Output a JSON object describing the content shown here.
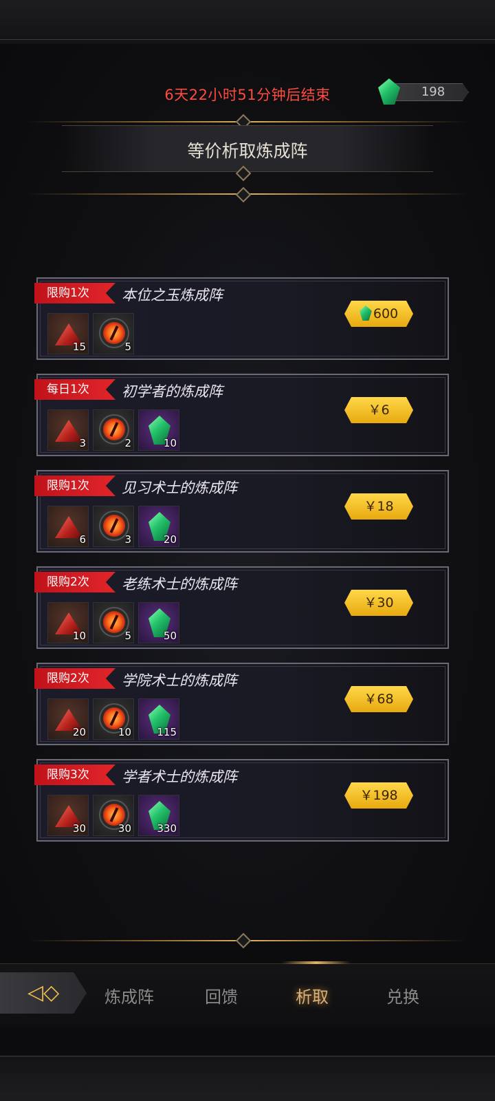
{
  "header": {
    "timer_text": "6天22小时51分钟后结束",
    "currency_count": "198",
    "currency_icon": "green-gem-icon",
    "title": "等价析取炼成阵"
  },
  "cards": [
    {
      "tag": "限购1次",
      "name": "本位之玉炼成阵",
      "items": [
        {
          "icon": "red-shard-icon",
          "count": "15"
        },
        {
          "icon": "fire-eye-icon",
          "count": "5"
        }
      ],
      "price": "600",
      "price_uses_gem": true
    },
    {
      "tag": "每日1次",
      "name": "初学者的炼成阵",
      "items": [
        {
          "icon": "red-shard-icon",
          "count": "3"
        },
        {
          "icon": "fire-eye-icon",
          "count": "2"
        },
        {
          "icon": "green-gem-icon",
          "count": "10"
        }
      ],
      "price": "￥6",
      "price_uses_gem": false
    },
    {
      "tag": "限购1次",
      "name": "见习术士的炼成阵",
      "items": [
        {
          "icon": "red-shard-icon",
          "count": "6"
        },
        {
          "icon": "fire-eye-icon",
          "count": "3"
        },
        {
          "icon": "green-gem-icon",
          "count": "20"
        }
      ],
      "price": "￥18",
      "price_uses_gem": false
    },
    {
      "tag": "限购2次",
      "name": "老练术士的炼成阵",
      "items": [
        {
          "icon": "red-shard-icon",
          "count": "10"
        },
        {
          "icon": "fire-eye-icon",
          "count": "5"
        },
        {
          "icon": "green-gem-icon",
          "count": "50"
        }
      ],
      "price": "￥30",
      "price_uses_gem": false
    },
    {
      "tag": "限购2次",
      "name": "学院术士的炼成阵",
      "items": [
        {
          "icon": "red-shard-icon",
          "count": "20"
        },
        {
          "icon": "fire-eye-icon",
          "count": "10"
        },
        {
          "icon": "green-gem-icon",
          "count": "115"
        }
      ],
      "price": "￥68",
      "price_uses_gem": false
    },
    {
      "tag": "限购3次",
      "name": "学者术士的炼成阵",
      "items": [
        {
          "icon": "red-shard-icon",
          "count": "30"
        },
        {
          "icon": "fire-eye-icon",
          "count": "30"
        },
        {
          "icon": "green-gem-icon",
          "count": "330"
        }
      ],
      "price": "￥198",
      "price_uses_gem": false
    }
  ],
  "tabbar": {
    "home_icon": "back-arrow-icon",
    "tabs": [
      "炼成阵",
      "回馈",
      "析取",
      "兑换"
    ],
    "active_tab": "析取"
  },
  "colors": {
    "timer": "#ff4a3d",
    "tag": "#d81e24",
    "price_button": "#f2c22a",
    "active_tab": "#d6b27a"
  }
}
